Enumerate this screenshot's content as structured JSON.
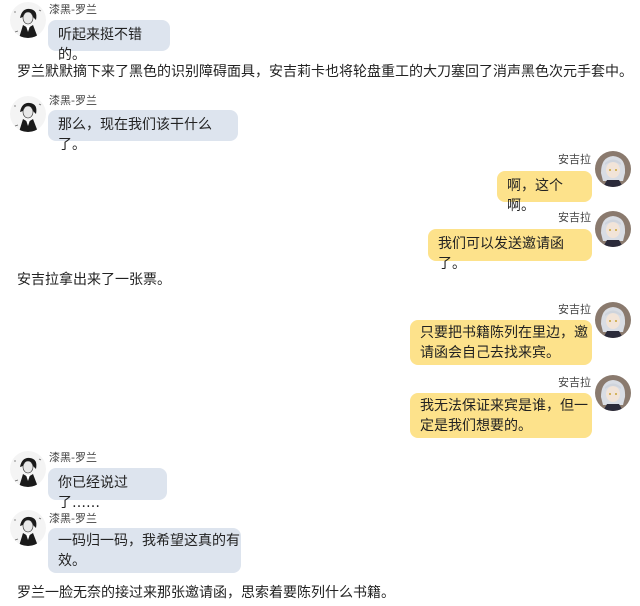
{
  "colors": {
    "left_bubble": "#dde4ee",
    "right_bubble": "#fde28b",
    "background": "#ffffff"
  },
  "messages": [
    {
      "speaker": "漆黑-罗兰",
      "avatar_icon": "roland-sketch-avatar-icon",
      "text": "听起来挺不错的。"
    },
    {
      "narration": "罗兰默默摘下来了黑色的识别障碍面具，安吉莉卡也将轮盘重工的大刀塞回了消声黑色次元手套中。"
    },
    {
      "speaker": "漆黑-罗兰",
      "avatar_icon": "roland-sketch-avatar-icon",
      "text": "那么，现在我们该干什么了。"
    },
    {
      "speaker": "安吉拉",
      "avatar_icon": "angela-portrait-avatar-icon",
      "text": "啊，这个啊。"
    },
    {
      "speaker": "安吉拉",
      "avatar_icon": "angela-portrait-avatar-icon",
      "text": "我们可以发送邀请函了。"
    },
    {
      "narration": "安吉拉拿出来了一张票。"
    },
    {
      "speaker": "安吉拉",
      "avatar_icon": "angela-portrait-avatar-icon",
      "lines": [
        "只要把书籍陈列在里边，邀",
        "请函会自己去找来宾。"
      ]
    },
    {
      "speaker": "安吉拉",
      "avatar_icon": "angela-portrait-avatar-icon",
      "lines": [
        "我无法保证来宾是谁，但一",
        "定是我们想要的。"
      ]
    },
    {
      "speaker": "漆黑-罗兰",
      "avatar_icon": "roland-sketch-avatar-icon",
      "text": "你已经说过了……"
    },
    {
      "speaker": "漆黑-罗兰",
      "avatar_icon": "roland-sketch-avatar-icon",
      "lines": [
        "一码归一码，我希望这真的有",
        "效。"
      ]
    },
    {
      "narration": "罗兰一脸无奈的接过来那张邀请函，思索着要陈列什么书籍。"
    }
  ]
}
